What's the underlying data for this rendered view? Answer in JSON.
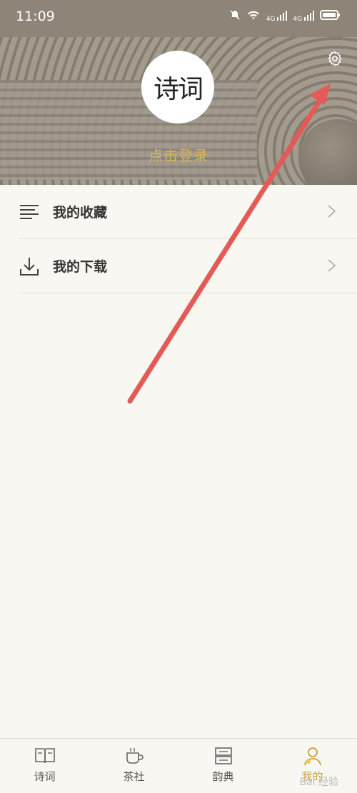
{
  "status_bar": {
    "time": "11:09",
    "signal_label": "4G"
  },
  "header": {
    "login_text": "点击登录",
    "avatar_logo": "诗词"
  },
  "menu": {
    "items": [
      {
        "label": "我的收藏",
        "icon": "list-icon"
      },
      {
        "label": "我的下载",
        "icon": "download-icon"
      }
    ]
  },
  "tabbar": {
    "tabs": [
      {
        "label": "诗词",
        "icon": "book-icon",
        "active": false
      },
      {
        "label": "茶社",
        "icon": "cup-icon",
        "active": false
      },
      {
        "label": "韵典",
        "icon": "dictionary-icon",
        "active": false
      },
      {
        "label": "我的",
        "icon": "profile-icon",
        "active": true
      }
    ]
  },
  "watermark": "Bai 经验",
  "colors": {
    "accent": "#d7b35b",
    "active_tab": "#c99c3b",
    "annotation_arrow": "#e35a57"
  }
}
